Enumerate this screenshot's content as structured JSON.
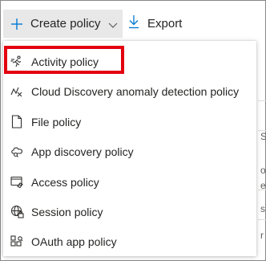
{
  "toolbar": {
    "create_label": "Create policy",
    "export_label": "Export"
  },
  "menu": {
    "items": [
      {
        "label": "Activity policy",
        "icon": "activity-icon"
      },
      {
        "label": "Cloud Discovery anomaly detection policy",
        "icon": "anomaly-icon"
      },
      {
        "label": "File policy",
        "icon": "file-icon"
      },
      {
        "label": "App discovery policy",
        "icon": "cloud-icon"
      },
      {
        "label": "Access policy",
        "icon": "access-icon"
      },
      {
        "label": "Session policy",
        "icon": "globe-icon"
      },
      {
        "label": "OAuth app policy",
        "icon": "oauth-icon"
      }
    ]
  },
  "colors": {
    "button_bg": "#e8e8e8",
    "accent": "#0078d4",
    "highlight": "#e3000f"
  }
}
